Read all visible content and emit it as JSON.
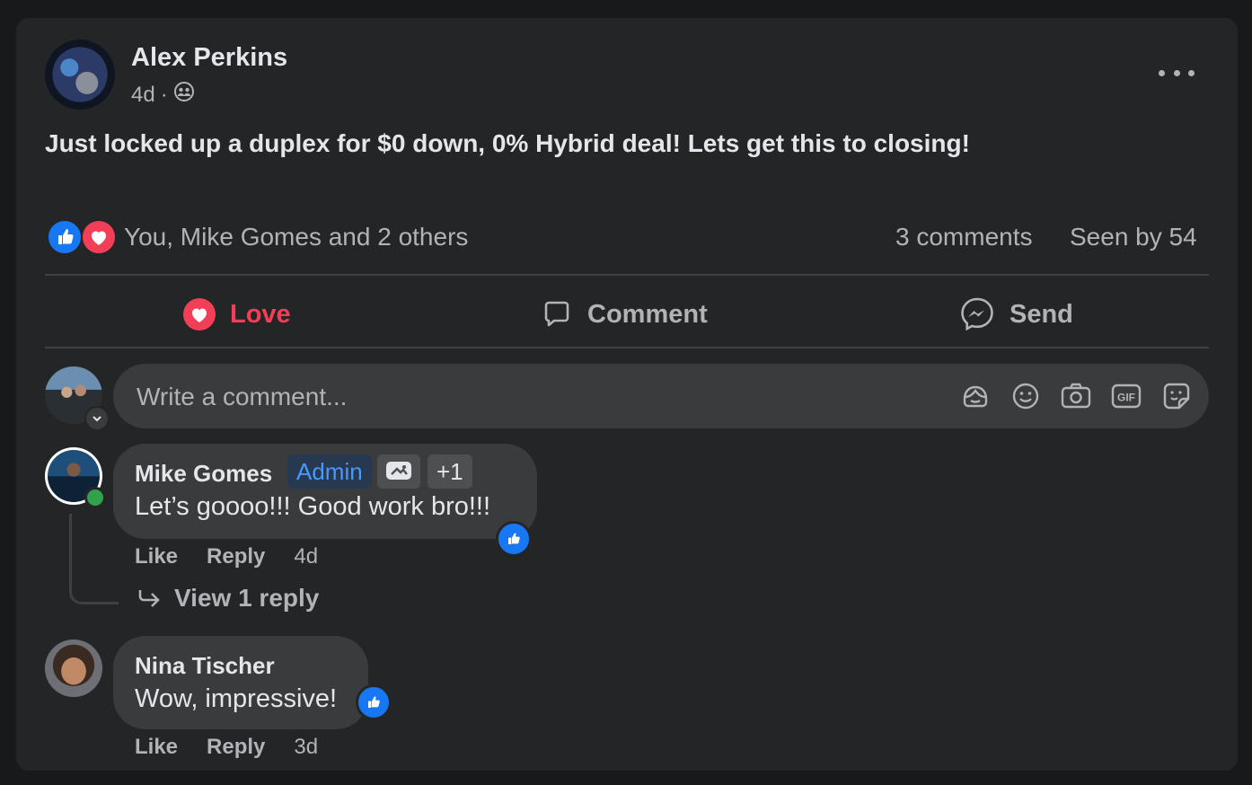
{
  "post": {
    "author": "Alex Perkins",
    "time": "4d",
    "separator": "·",
    "audience_icon": "friends-icon",
    "more_icon": "more-options-icon",
    "text": "Just locked up a duplex for $0 down, 0% Hybrid deal! Lets get this to closing!"
  },
  "reactions": {
    "icons": [
      "like-icon",
      "love-icon"
    ],
    "summary": "You, Mike Gomes and 2 others",
    "comments_count": "3 comments",
    "seen_by": "Seen by 54"
  },
  "actions": {
    "love": "Love",
    "comment": "Comment",
    "send": "Send"
  },
  "composer": {
    "placeholder": "Write a comment...",
    "tools": [
      "avatar-sticker-icon",
      "emoji-icon",
      "camera-icon",
      "gif-icon",
      "sticker-icon"
    ]
  },
  "comments": [
    {
      "author": "Mike Gomes",
      "badge": "Admin",
      "badge_extra": "+1",
      "text": "Let’s goooo!!! Good work bro!!!",
      "like": "Like",
      "reply": "Reply",
      "time": "4d",
      "view_replies": "View 1 reply",
      "online": true
    },
    {
      "author": "Nina Tischer",
      "text": "Wow, impressive!",
      "like": "Like",
      "reply": "Reply",
      "time": "3d"
    }
  ],
  "colors": {
    "background": "#18191a",
    "card": "#242526",
    "bubble": "#3a3b3c",
    "text_primary": "#e4e6eb",
    "text_secondary": "#b0b3b8",
    "love_red": "#f33e58",
    "like_blue": "#1877f2",
    "admin_blue": "#4599ff",
    "online_green": "#31a24c"
  }
}
